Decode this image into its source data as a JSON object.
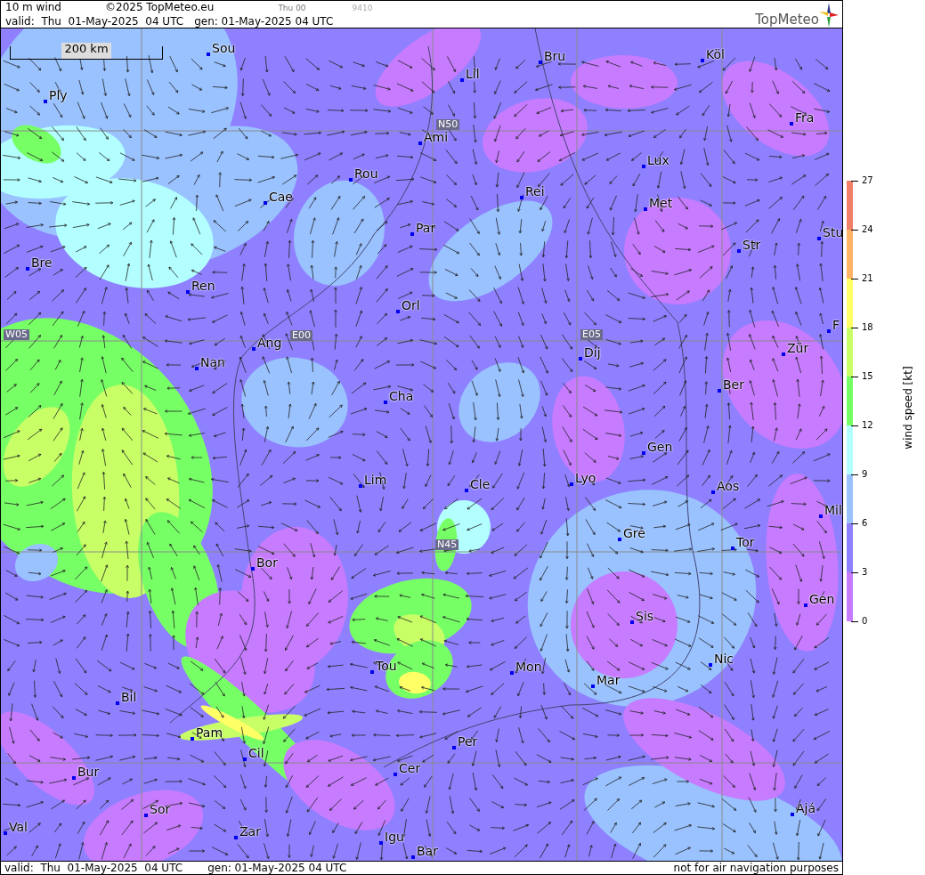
{
  "header": {
    "title": "10 m wind",
    "copyright": "©2025 TopMeteo.eu",
    "time_code": "Thu 00",
    "code": "9410",
    "valid": "valid:  Thu  01-May-2025  04 UTC",
    "gen": "gen: 01-May-2025 04 UTC"
  },
  "logo": {
    "text": "TopMeteo"
  },
  "map": {
    "scale": "200 km",
    "grid_labels": [
      "N50",
      "E00",
      "E05",
      "N45",
      "W05"
    ],
    "cities": [
      {
        "name": "Sou"
      },
      {
        "name": "Ply"
      },
      {
        "name": "Lil"
      },
      {
        "name": "Bru"
      },
      {
        "name": "Köl"
      },
      {
        "name": "Fra"
      },
      {
        "name": "Ami"
      },
      {
        "name": "Lux"
      },
      {
        "name": "Rou"
      },
      {
        "name": "Rei"
      },
      {
        "name": "Cae"
      },
      {
        "name": "Met"
      },
      {
        "name": "Par"
      },
      {
        "name": "Str"
      },
      {
        "name": "Stu"
      },
      {
        "name": "Bre"
      },
      {
        "name": "Ren"
      },
      {
        "name": "Orl"
      },
      {
        "name": "Zür"
      },
      {
        "name": "F"
      },
      {
        "name": "Ang"
      },
      {
        "name": "Dij"
      },
      {
        "name": "Nan"
      },
      {
        "name": "Ber"
      },
      {
        "name": "Cha"
      },
      {
        "name": "Gen"
      },
      {
        "name": "Lim"
      },
      {
        "name": "Cle"
      },
      {
        "name": "Lyo"
      },
      {
        "name": "Aos"
      },
      {
        "name": "Mil"
      },
      {
        "name": "Gre"
      },
      {
        "name": "Tor"
      },
      {
        "name": "Bor"
      },
      {
        "name": "Sis"
      },
      {
        "name": "Gen"
      },
      {
        "name": "Tou"
      },
      {
        "name": "Mon"
      },
      {
        "name": "Nic"
      },
      {
        "name": "Mar"
      },
      {
        "name": "Bil"
      },
      {
        "name": "Pam"
      },
      {
        "name": "Per"
      },
      {
        "name": "Cil"
      },
      {
        "name": "Cer"
      },
      {
        "name": "Bur"
      },
      {
        "name": "Sor"
      },
      {
        "name": "Zar"
      },
      {
        "name": "Ajá"
      },
      {
        "name": "Val"
      },
      {
        "name": "Igu"
      },
      {
        "name": "Bar"
      }
    ]
  },
  "legend": {
    "title": "wind speed [kt]",
    "ticks": [
      "27",
      "24",
      "21",
      "18",
      "15",
      "12",
      "9",
      "6",
      "3",
      "0"
    ],
    "bands": [
      {
        "color": "#f08068"
      },
      {
        "color": "#ffb366"
      },
      {
        "color": "#ffff66"
      },
      {
        "color": "#c8ff66"
      },
      {
        "color": "#77ff66"
      },
      {
        "color": "#b3ffff"
      },
      {
        "color": "#99c2ff"
      },
      {
        "color": "#8f80ff"
      },
      {
        "color": "#c77bff"
      }
    ]
  },
  "footer": {
    "valid": "valid:  Thu  01-May-2025  04 UTC",
    "gen": "gen: 01-May-2025 04 UTC",
    "disclaimer": "not for air navigation purposes"
  }
}
